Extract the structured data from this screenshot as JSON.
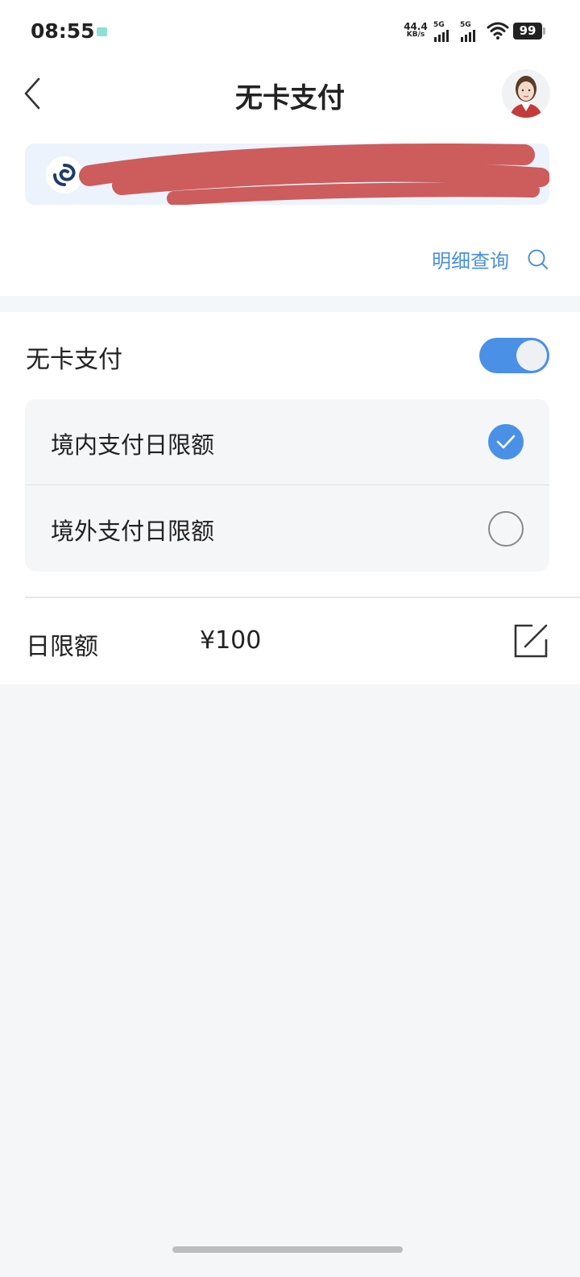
{
  "status_bar": {
    "time": "08:55",
    "net_speed_value": "44.4",
    "net_speed_unit": "KB/s",
    "sim1_label": "5G",
    "sim2_label": "5G",
    "battery": "99"
  },
  "header": {
    "title": "无卡支付",
    "back_icon": "chevron-left-icon",
    "avatar": "assistant-avatar"
  },
  "account": {
    "card_text": "",
    "redacted": true,
    "bank_logo_icon": "bank-logo-icon"
  },
  "detail": {
    "label": "明细查询",
    "icon": "search-icon"
  },
  "settings": {
    "toggle_label": "无卡支付",
    "toggle_on": true,
    "options": [
      {
        "label": "境内支付日限额",
        "selected": true
      },
      {
        "label": "境外支付日限额",
        "selected": false
      }
    ],
    "daily_limit_label": "日限额",
    "daily_limit_value": "¥100",
    "edit_icon": "edit-icon"
  },
  "colors": {
    "accent": "#4a90e6",
    "link": "#4a8fe0",
    "background": "#f5f6f8",
    "card": "#ecf3fc",
    "redaction": "#cd5c5c"
  }
}
